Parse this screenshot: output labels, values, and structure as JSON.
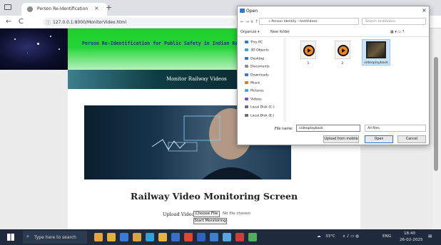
{
  "browser": {
    "tab_title": "Person Re-Identification",
    "tab_close": "×",
    "new_tab": "+",
    "url": "127.0.0.1:8000/MonitorVideo.html",
    "nav_back": "←",
    "nav_reload": "C"
  },
  "page": {
    "banner_title": "Person Re-Identification for Public Safety in Indian Railways usi",
    "nav_link": "Monitor Railway Videos",
    "heading": "Railway Video Monitoring Screen",
    "upload_label": "Upload Video",
    "choose_file": "Choose File",
    "no_file": "No file chosen",
    "start_button": "Start Monitoring"
  },
  "dialog": {
    "title": "Open",
    "close": "×",
    "path": "« Person Identify › testVideos",
    "search_placeholder": "Search testVideos",
    "organize": "Organize ▾",
    "new_folder": "New folder",
    "tree": [
      {
        "label": "This PC",
        "color": "#2b78d6"
      },
      {
        "label": "3D Objects",
        "color": "#3aa0e0"
      },
      {
        "label": "Desktop",
        "color": "#2b78d6"
      },
      {
        "label": "Documents",
        "color": "#8b8b8b"
      },
      {
        "label": "Downloads",
        "color": "#2b78d6"
      },
      {
        "label": "Music",
        "color": "#e07a2b"
      },
      {
        "label": "Pictures",
        "color": "#4aa3df"
      },
      {
        "label": "Videos",
        "color": "#7a52c7"
      },
      {
        "label": "Local Disk (C:)",
        "color": "#6c6c6c"
      },
      {
        "label": "Local Disk (E:)",
        "color": "#6c6c6c"
      }
    ],
    "files": [
      {
        "name": "1"
      },
      {
        "name": "2"
      },
      {
        "name": "videoplayback"
      }
    ],
    "file_name_label": "File name:",
    "file_name_value": "videoplayback",
    "file_type": "All files",
    "upload_mobile": "Upload from mobile",
    "open": "Open",
    "cancel": "Cancel"
  },
  "taskbar": {
    "search_placeholder": "Type here to search",
    "weather": "33°C",
    "lang": "ENG",
    "time": "18:40",
    "date": "26-02-2025"
  }
}
